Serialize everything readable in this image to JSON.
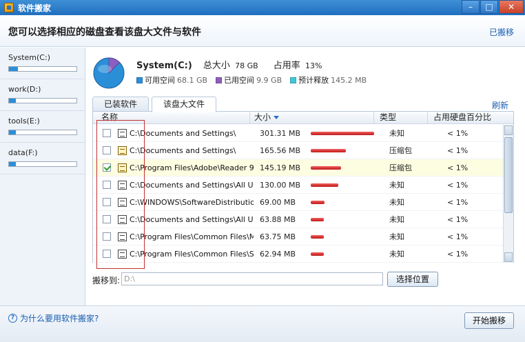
{
  "window": {
    "title": "软件搬家",
    "minimize": "–",
    "maximize": "□",
    "close": "✕"
  },
  "header": {
    "heading": "您可以选择相应的磁盘查看该盘大文件与软件",
    "link": "已搬移"
  },
  "sidebar": {
    "drives": [
      {
        "label": "System(C:)",
        "used_fraction": 0.13
      },
      {
        "label": "work(D:)",
        "used_fraction": 0.1
      },
      {
        "label": "tools(E:)",
        "used_fraction": 0.1
      },
      {
        "label": "data(F:)",
        "used_fraction": 0.1
      }
    ]
  },
  "summary": {
    "drive_name": "System(C:)",
    "total_label": "总大小",
    "total_value": "78 GB",
    "usage_label": "占用率",
    "usage_value": "13%",
    "legend": [
      {
        "label": "可用空间",
        "value": "68.1 GB",
        "color": "#2b8fd8"
      },
      {
        "label": "已用空间",
        "value": "9.9 GB",
        "color": "#8b5fbf"
      },
      {
        "label": "预计释放",
        "value": "145.2 MB",
        "color": "#40c8d8"
      }
    ]
  },
  "tabs": [
    {
      "label": "已装软件"
    },
    {
      "label": "该盘大文件"
    }
  ],
  "refresh": "刷新",
  "table": {
    "headers": {
      "name": "名称",
      "size": "大小",
      "type": "类型",
      "percent": "占用硬盘百分比"
    },
    "rows": [
      {
        "path": "C:\\Documents and Settings\\",
        "size": "301.31 MB",
        "type": "未知",
        "percent": "< 1%",
        "checked": false,
        "bar": 1.0,
        "icon": "file"
      },
      {
        "path": "C:\\Documents and Settings\\",
        "size": "165.56 MB",
        "type": "压缩包",
        "percent": "< 1%",
        "checked": false,
        "bar": 0.55,
        "icon": "zip"
      },
      {
        "path": "C:\\Program Files\\Adobe\\Reader 9...",
        "size": "145.19 MB",
        "type": "压缩包",
        "percent": "< 1%",
        "checked": true,
        "bar": 0.48,
        "icon": "zip"
      },
      {
        "path": "C:\\Documents and Settings\\All Us...",
        "size": "130.00 MB",
        "type": "未知",
        "percent": "< 1%",
        "checked": false,
        "bar": 0.43,
        "icon": "file"
      },
      {
        "path": "C:\\WINDOWS\\SoftwareDistributio...",
        "size": "69.00 MB",
        "type": "未知",
        "percent": "< 1%",
        "checked": false,
        "bar": 0.22,
        "icon": "file"
      },
      {
        "path": "C:\\Documents and Settings\\All Us...",
        "size": "63.88 MB",
        "type": "未知",
        "percent": "< 1%",
        "checked": false,
        "bar": 0.21,
        "icon": "file"
      },
      {
        "path": "C:\\Program Files\\Common Files\\Mi...",
        "size": "63.75 MB",
        "type": "未知",
        "percent": "< 1%",
        "checked": false,
        "bar": 0.21,
        "icon": "file"
      },
      {
        "path": "C:\\Program Files\\Common Files\\S...",
        "size": "62.94 MB",
        "type": "未知",
        "percent": "< 1%",
        "checked": false,
        "bar": 0.21,
        "icon": "file"
      }
    ]
  },
  "moveto": {
    "label": "搬移到:",
    "value": "D:\\",
    "button": "选择位置"
  },
  "footer": {
    "help": "为什么要用软件搬家?",
    "help_icon": "?",
    "start_button": "开始搬移"
  }
}
